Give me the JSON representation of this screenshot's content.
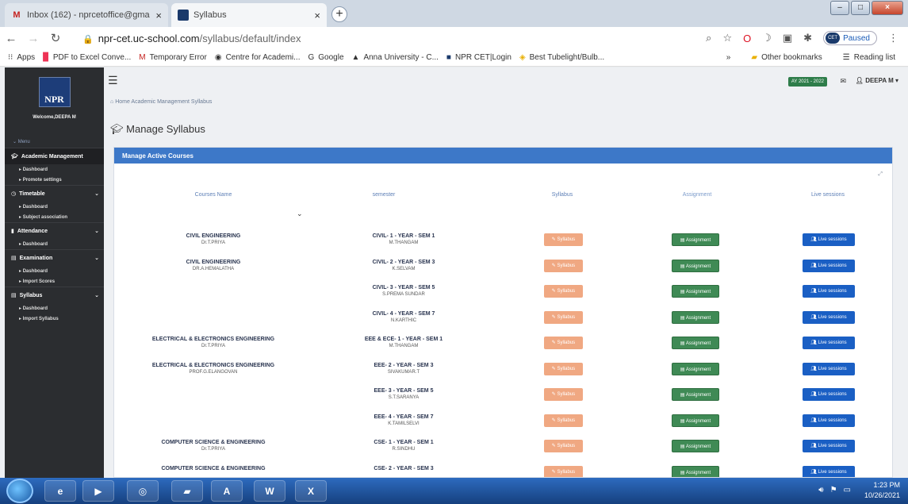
{
  "browser": {
    "tabs": [
      {
        "title": "Inbox (162) - nprcetoffice@gma",
        "icon": "gmail-icon"
      },
      {
        "title": "Syllabus",
        "icon": "npr-icon"
      }
    ],
    "url_host": "npr-cet.uc-school.com",
    "url_path": "/syllabus/default/index",
    "profile_status": "Paused",
    "profile_label": "CET",
    "bookmarks": [
      "Apps",
      "PDF to Excel Conve...",
      "Temporary Error",
      "Centre for Academi...",
      "Google",
      "Anna University - C...",
      "NPR CET|Login",
      "Best Tubelight/Bulb..."
    ],
    "other_bookmarks": "Other bookmarks",
    "reading_list": "Reading list",
    "more": "»"
  },
  "sidebar": {
    "logo": "NPR",
    "welcome": "Welcome,DEEPA M",
    "menu_label": "Menu",
    "groups": [
      {
        "label": "Academic Management",
        "items": [
          "Dashboard",
          "Promote settings"
        ],
        "active": true
      },
      {
        "label": "Timetable",
        "items": [
          "Dashboard",
          "Subject association"
        ]
      },
      {
        "label": "Attendance",
        "items": [
          "Dashboard"
        ]
      },
      {
        "label": "Examination",
        "items": [
          "Dashboard",
          "Import Scores"
        ]
      },
      {
        "label": "Syllabus",
        "items": [
          "Dashboard",
          "Import Syllabus"
        ]
      }
    ]
  },
  "header": {
    "academic_year": "AY 2021 - 2022",
    "user": "DEEPA M"
  },
  "breadcrumb": "Home  Academic Management  Syllabus",
  "page_title": "Manage Syllabus",
  "card": {
    "title": "Manage Active Courses",
    "columns": [
      "Courses Name",
      "semester",
      "Syllabus",
      "Assignment",
      "Live sessions"
    ],
    "buttons": {
      "syllabus": "Syllabus",
      "assignment": "Assignment",
      "live": "Live sessions"
    },
    "rows": [
      {
        "course": "CIVIL ENGINEERING",
        "faculty": "Dr.T.PRIYA",
        "semester": "CIVIL- 1 - YEAR - SEM 1",
        "sem_faculty": "M.THANGAM"
      },
      {
        "course": "CIVIL ENGINEERING",
        "faculty": "DR.A.HEMALATHA",
        "semester": "CIVIL- 2 - YEAR - SEM 3",
        "sem_faculty": "K.SELVAM"
      },
      {
        "course": "",
        "faculty": "",
        "semester": "CIVIL- 3 - YEAR - SEM 5",
        "sem_faculty": "S.PREMA SUNDAR"
      },
      {
        "course": "",
        "faculty": "",
        "semester": "CIVIL- 4 - YEAR - SEM 7",
        "sem_faculty": "N.KARTHIC"
      },
      {
        "course": "ELECTRICAL & ELECTRONICS ENGINEERING",
        "faculty": "Dr.T.PRIYA",
        "semester": "EEE & ECE- 1 - YEAR - SEM 1",
        "sem_faculty": "M.THANGAM"
      },
      {
        "course": "ELECTRICAL & ELECTRONICS ENGINEERING",
        "faculty": "PROF.G.ELANGOVAN",
        "semester": "EEE- 2 - YEAR - SEM 3",
        "sem_faculty": "SIVAKUMAR.T"
      },
      {
        "course": "",
        "faculty": "",
        "semester": "EEE- 3 - YEAR - SEM 5",
        "sem_faculty": "S.T.SARANYA"
      },
      {
        "course": "",
        "faculty": "",
        "semester": "EEE- 4 - YEAR - SEM 7",
        "sem_faculty": "K.TAMILSELVI"
      },
      {
        "course": "COMPUTER SCIENCE & ENGINEERING",
        "faculty": "Dr.T.PRIYA",
        "semester": "CSE- 1 - YEAR - SEM 1",
        "sem_faculty": "R.SINDHU"
      },
      {
        "course": "COMPUTER SCIENCE & ENGINEERING",
        "faculty": "",
        "semester": "CSE- 2 - YEAR - SEM 3",
        "sem_faculty": ""
      }
    ]
  },
  "taskbar": {
    "time": "1:23 PM",
    "date": "10/26/2021"
  }
}
